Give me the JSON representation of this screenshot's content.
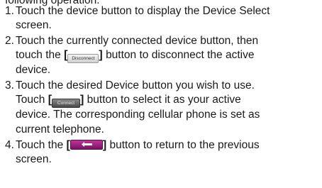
{
  "intro": "following operation:",
  "steps": [
    {
      "num": "1.",
      "l1": "Touch the device button to display the Device Select",
      "l2": "screen."
    },
    {
      "num": "2.",
      "l1": "Touch the currently connected device button, then",
      "l2_pre": "touch the",
      "l2_post": "button to disconnect the active",
      "l3": "device.",
      "button_label": "Disconnect"
    },
    {
      "num": "3.",
      "l1": "Touch the desired Device button you wish to use.",
      "l2_pre": "Touch",
      "l2_post": "button to select it as your active",
      "l3": "device. The corresponding cellular phone is set as",
      "l4": "current telephone.",
      "button_label": "Connect"
    },
    {
      "num": "4.",
      "l1_pre": "Touch the",
      "l1_post": "button to return to the previous",
      "l2": "screen.",
      "button_icon": "back-arrow-icon"
    }
  ],
  "colors": {
    "text": "#1a1a1a",
    "back_button": "#9e1f86"
  }
}
